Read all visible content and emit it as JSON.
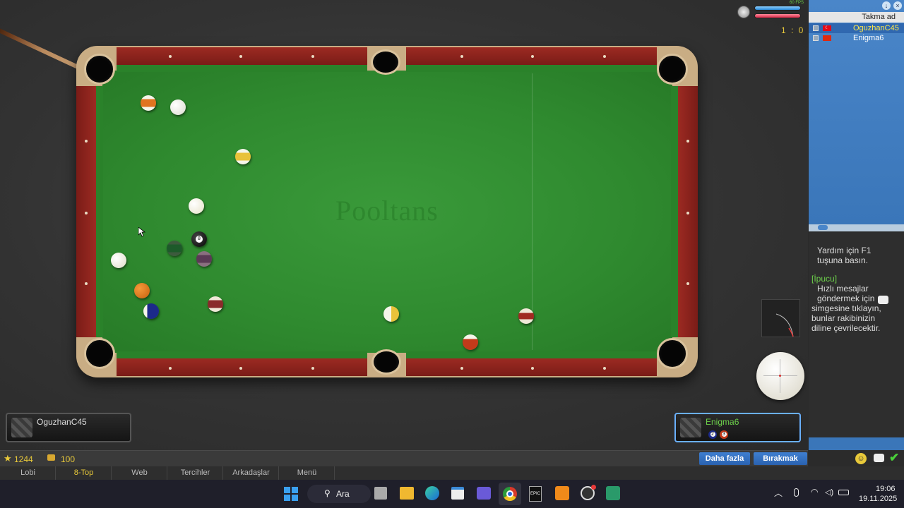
{
  "hud": {
    "fps": "60 FPS",
    "score": "1 : 0"
  },
  "table": {
    "watermark": "Pooltans"
  },
  "players": {
    "left": {
      "name": "OguzhanC45"
    },
    "right": {
      "name": "Enigma6",
      "balls": [
        "2",
        "3"
      ]
    }
  },
  "status": {
    "stars": "1244",
    "coins": "100"
  },
  "actions": {
    "more": "Daha fazla",
    "quit": "Bırakmak"
  },
  "nav": [
    "Lobi",
    "8-Top",
    "Web",
    "Tercihler",
    "Arkadaşlar",
    "Menü"
  ],
  "sidebar": {
    "header": "Takma ad",
    "players": [
      "OguzhanC45",
      "Enigma6"
    ],
    "help": "Yardım için F1 tuşuna basın.",
    "tip_title": "[İpucu]",
    "tip_body": "Hızlı mesajlar göndermek için",
    "tip_body2": "simgesine tıklayın, bunlar rakibinizin diline çevrilecektir."
  },
  "taskbar": {
    "search": "Ara",
    "time": "19:06",
    "date": "19.11.2025"
  },
  "colors": {
    "accent": "#3f7fd0",
    "felt": "#2f8a2f",
    "rail": "#8a2420",
    "active_nav": "#e8c93a",
    "player_name_green": "#6cd04a"
  }
}
